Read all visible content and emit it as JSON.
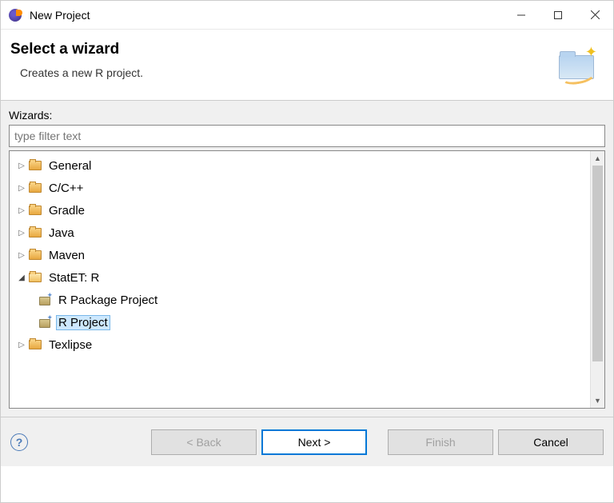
{
  "titlebar": {
    "title": "New Project"
  },
  "header": {
    "title": "Select a wizard",
    "description": "Creates a new R project."
  },
  "content": {
    "label": "Wizards:",
    "filter_placeholder": "type filter text",
    "tree": {
      "general": "General",
      "ccpp": "C/C++",
      "gradle": "Gradle",
      "java": "Java",
      "maven": "Maven",
      "statet": "StatET: R",
      "statet_pkg": "R Package Project",
      "statet_rproj": "R Project",
      "texlipse": "Texlipse"
    }
  },
  "footer": {
    "back": "< Back",
    "next": "Next >",
    "finish": "Finish",
    "cancel": "Cancel"
  }
}
